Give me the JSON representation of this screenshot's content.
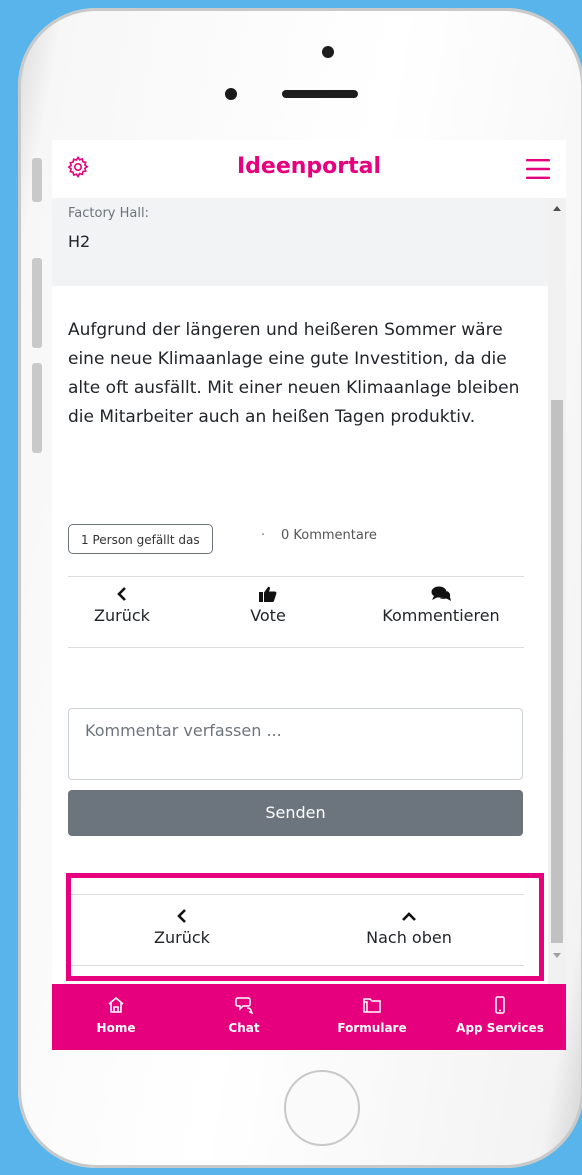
{
  "header": {
    "title": "Ideenportal",
    "settings_icon": "gear-icon",
    "menu_icon": "hamburger-menu-icon",
    "accent_color": "#e6007e"
  },
  "details": {
    "factory_hall_label": "Factory Hall:",
    "factory_hall_value": "H2",
    "description": "Aufgrund der längeren und heißeren Sommer wäre eine neue Klimaanlage eine gute Investition, da die alte oft ausfällt. Mit einer neuen Klimaanlage bleiben die Mitarbeiter auch an heißen Tagen produktiv."
  },
  "stats": {
    "likes": "1 Person gefällt das",
    "separator": "·",
    "comments": "0 Kommentare"
  },
  "actions": {
    "back": "Zurück",
    "vote": "Vote",
    "comment": "Kommentieren"
  },
  "comment_form": {
    "placeholder": "Kommentar verfassen ...",
    "send": "Senden"
  },
  "page_nav": {
    "back": "Zurück",
    "top": "Nach oben"
  },
  "tabbar": {
    "items": [
      {
        "label": "Home",
        "icon": "home-icon"
      },
      {
        "label": "Chat",
        "icon": "chat-icon"
      },
      {
        "label": "Formulare",
        "icon": "folder-icon"
      },
      {
        "label": "App Services",
        "icon": "mobile-icon"
      }
    ],
    "color": "#e6007e"
  }
}
